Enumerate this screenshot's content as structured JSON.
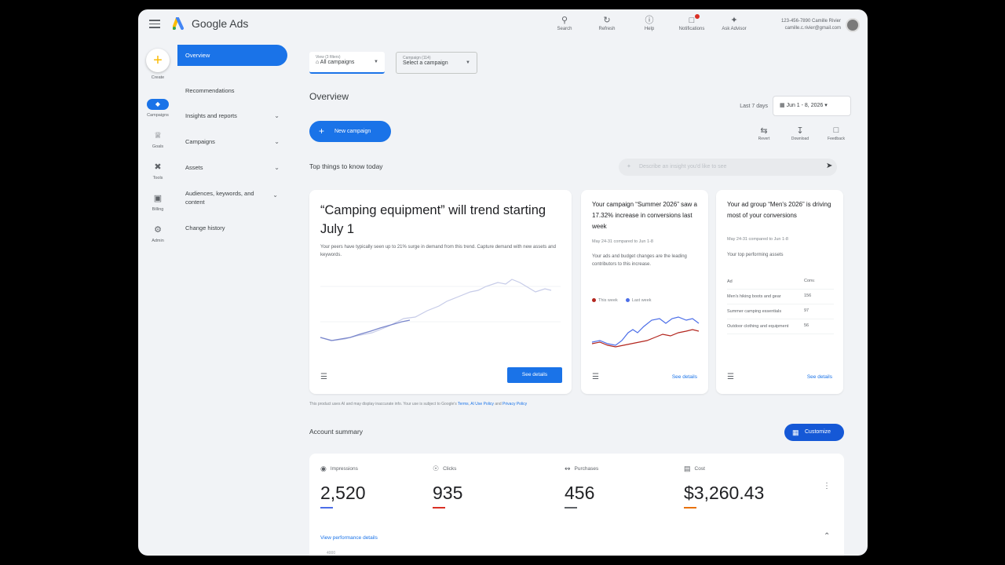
{
  "app": {
    "title": "Google Ads"
  },
  "header": {
    "icons": [
      {
        "label": "Search",
        "icon": "search-icon"
      },
      {
        "label": "Refresh",
        "icon": "refresh-icon"
      },
      {
        "label": "Help",
        "icon": "help-icon"
      },
      {
        "label": "Notifications",
        "icon": "bell-icon"
      },
      {
        "label": "Ask Advisor",
        "icon": "advisor-icon"
      }
    ],
    "account_id": "123-456-7890 Camille Rivier",
    "account_email": "camille.c.rivier@gmail.com"
  },
  "rail": {
    "items": [
      {
        "label": "Create",
        "icon": "plus-icon"
      },
      {
        "label": "Campaigns",
        "icon": "campaigns-icon"
      },
      {
        "label": "Goals",
        "icon": "trophy-icon"
      },
      {
        "label": "Tools",
        "icon": "tools-icon"
      },
      {
        "label": "Billing",
        "icon": "billing-icon"
      },
      {
        "label": "Admin",
        "icon": "gear-icon"
      }
    ]
  },
  "nav": {
    "items": [
      {
        "label": "Overview"
      },
      {
        "label": "Recommendations"
      },
      {
        "label": "Insights and reports"
      },
      {
        "label": "Campaigns"
      },
      {
        "label": "Assets"
      },
      {
        "label": "Audiences, keywords, and content"
      },
      {
        "label": "Change history"
      }
    ]
  },
  "filters": {
    "view_caption": "View (3 filters)",
    "view_value": "All campaigns",
    "campaign_caption": "Campaign (114)",
    "campaign_value": "Select a campaign"
  },
  "overview": {
    "title": "Overview",
    "new_campaign": "New campaign",
    "range_label": "Last 7 days",
    "date_range": "Jun 1 - 8, 2026",
    "actions": [
      "Revert",
      "Download",
      "Feedback"
    ],
    "top_things": "Top things to know today",
    "ask_placeholder": "Describe an insight you'd like to see"
  },
  "cards": {
    "trend": {
      "title": "“Camping equipment” will trend starting July 1",
      "body": "Your peers have typically seen up to 21% surge in demand from this trend. Capture demand with new assets and keywords.",
      "button": "See details"
    },
    "increase": {
      "title": "Your campaign “Summer 2026” saw a 17.32% increase in conversions last week",
      "date": "May 24-31 compared to Jun 1-8",
      "body": "Your ads and budget changes are the leading contributors to this increase.",
      "legend_this": "This week",
      "legend_last": "Last week",
      "link": "See details"
    },
    "adgroup": {
      "title": "Your ad group “Men's 2026” is driving most of your conversions",
      "date": "May 24-31 compared to Jun 1-8",
      "subtitle": "Your top performing assets",
      "col_ad": "Ad",
      "col_conv": "Conv.",
      "rows": [
        {
          "ad": "Men's hiking boots and gear",
          "conv": "156"
        },
        {
          "ad": "Summer camping essentials",
          "conv": "97"
        },
        {
          "ad": "Outdoor clothing and equipment",
          "conv": "56"
        }
      ],
      "link": "See details"
    }
  },
  "disclaimer": {
    "text": "This product uses AI and may display inaccurate info. Your use is subject to Google's",
    "link1": "Terms",
    "link2": "AI Use Policy",
    "and": "and",
    "link3": "Privacy Policy"
  },
  "summary": {
    "title": "Account summary",
    "customize": "Customize",
    "metrics": [
      {
        "label": "Impressions",
        "value": "2,520",
        "color": "#4c6ee8",
        "icon": "eye-icon"
      },
      {
        "label": "Clicks",
        "value": "935",
        "color": "#d93025",
        "icon": "click-icon"
      },
      {
        "label": "Purchases",
        "value": "456",
        "color": "#5f6368",
        "icon": "purchase-icon"
      },
      {
        "label": "Cost",
        "value": "$3,260.43",
        "color": "#e8710a",
        "icon": "cost-icon"
      }
    ],
    "perf_link": "View performance details",
    "axis_tick": "4000"
  },
  "colors": {
    "accent": "#1a73e8",
    "this_week": "#b3261e",
    "last_week": "#4c6ee8"
  }
}
